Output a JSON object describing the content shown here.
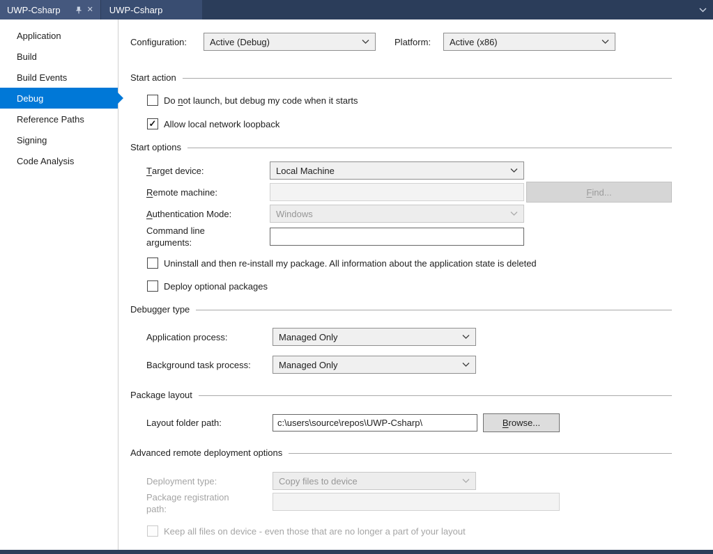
{
  "colors": {
    "accent": "#0078d7",
    "tab_bar_bg": "#2b3d5a",
    "active_tab_bg": "#45587e"
  },
  "tab_bar": {
    "active_tab": "UWP-Csharp",
    "inactive_tab": "UWP-Csharp"
  },
  "sidebar": {
    "items": [
      {
        "label": "Application"
      },
      {
        "label": "Build"
      },
      {
        "label": "Build Events"
      },
      {
        "label": "Debug"
      },
      {
        "label": "Reference Paths"
      },
      {
        "label": "Signing"
      },
      {
        "label": "Code Analysis"
      }
    ],
    "selected_item": "Debug"
  },
  "config_row": {
    "configuration_label": "Configuration:",
    "configuration_value": "Active (Debug)",
    "platform_label": "Platform:",
    "platform_value": "Active (x86)"
  },
  "start_action": {
    "title": "Start action",
    "no_launch": {
      "label": "Do &not launch, but debug my code when it starts",
      "checked": false
    },
    "loopback": {
      "label": "Allow local network loopback",
      "checked": true
    }
  },
  "start_options": {
    "title": "Start options",
    "target_device": {
      "label": "&Target device:",
      "value": "Local Machine"
    },
    "remote_machine": {
      "label": "&Remote machine:",
      "value": ""
    },
    "find_button": "&Find...",
    "auth_mode": {
      "label": "&Authentication Mode:",
      "value": "Windows"
    },
    "command_line": {
      "label": "Command line arguments:",
      "value": ""
    },
    "uninstall": {
      "label": "Uninstall and then re-install my package. All information about the application state is deleted",
      "checked": false
    },
    "deploy_optional": {
      "label": "Deploy optional packages",
      "checked": false
    }
  },
  "debugger_type": {
    "title": "Debugger type",
    "application_process": {
      "label": "Application process:",
      "value": "Managed Only"
    },
    "background_task": {
      "label": "Background task process:",
      "value": "Managed Only"
    }
  },
  "package_layout": {
    "title": "Package layout",
    "layout_folder": {
      "label": "Layout folder path:",
      "value": "c:\\users\\source\\repos\\UWP-Csharp\\"
    },
    "browse_button": "&Browse..."
  },
  "advanced": {
    "title": "Advanced remote deployment options",
    "deployment_type": {
      "label": "Deployment type:",
      "value": "Copy files to device"
    },
    "registration_path": {
      "label": "Package registration path:",
      "value": ""
    },
    "keep_files": {
      "label": "Keep all files on device - even those that are no longer a part of your layout",
      "checked": false
    }
  }
}
